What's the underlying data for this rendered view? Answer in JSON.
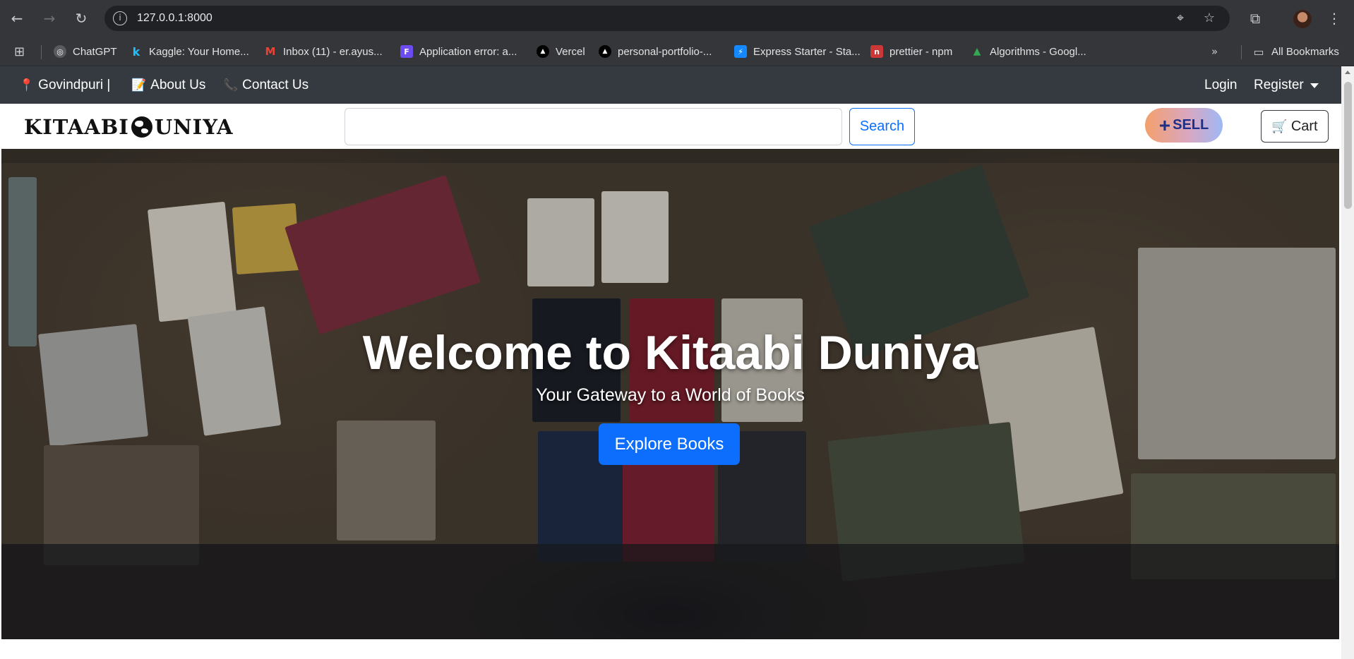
{
  "browser": {
    "url": "127.0.0.1:8000",
    "bookmarks": [
      {
        "label": "ChatGPT",
        "icon": "chatgpt-icon",
        "color": "#5a5b5f"
      },
      {
        "label": "Kaggle: Your Home...",
        "icon": "kaggle-icon",
        "color": "#20beff"
      },
      {
        "label": "Inbox (11) - er.ayus...",
        "icon": "gmail-icon",
        "color": "#ea4335"
      },
      {
        "label": "Application error: a...",
        "icon": "app-icon",
        "color": "#6c4cf0"
      },
      {
        "label": "Vercel",
        "icon": "vercel-icon",
        "color": "#000000"
      },
      {
        "label": "personal-portfolio-...",
        "icon": "vercel-icon",
        "color": "#000000"
      },
      {
        "label": "Express Starter - Sta...",
        "icon": "bolt-icon",
        "color": "#1389fd"
      },
      {
        "label": "prettier - npm",
        "icon": "npm-icon",
        "color": "#cb3837"
      },
      {
        "label": "Algorithms - Googl...",
        "icon": "drive-icon",
        "color": "#34a853"
      }
    ],
    "all_bookmarks": "All Bookmarks"
  },
  "topbar": {
    "location": "Govindpuri |",
    "about": "About Us",
    "contact": "Contact Us",
    "login": "Login",
    "register": "Register"
  },
  "header": {
    "logo_left": "KITAABI",
    "logo_right": "UNIYA",
    "search_value": "",
    "search_label": "Search",
    "sell_label": "SELL",
    "cart_label": "Cart"
  },
  "hero": {
    "title": "Welcome to Kitaabi Duniya",
    "subtitle": "Your Gateway to a World of Books",
    "cta": "Explore Books"
  },
  "colors": {
    "topbar": "#343a40",
    "primary": "#0d6efd",
    "sell_text": "#1e2f86"
  }
}
